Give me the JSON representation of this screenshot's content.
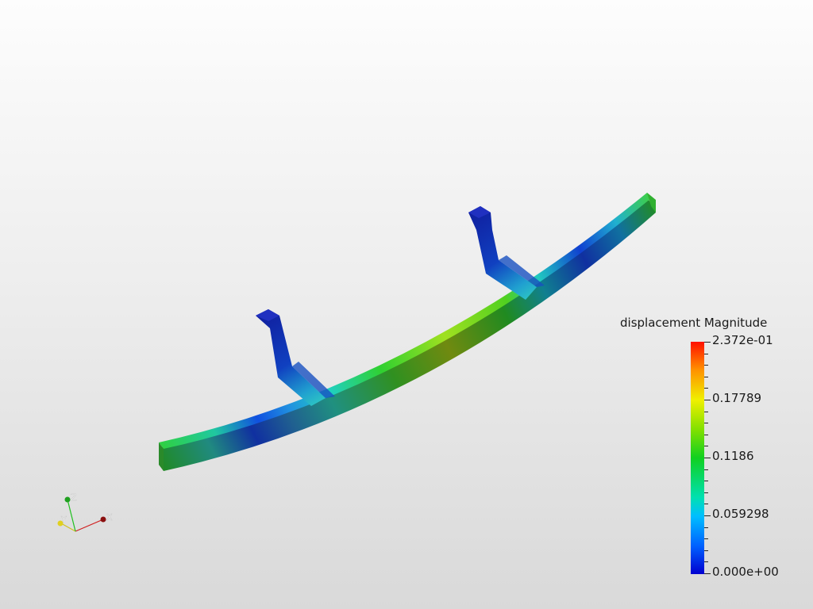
{
  "scalar_bar": {
    "title": "displacement Magnitude",
    "ticks": [
      "2.372e-01",
      "0.17789",
      "0.1186",
      "0.059298",
      "0.000e+00"
    ]
  },
  "axes": {
    "x": "X",
    "y": "Y",
    "z": "Z"
  },
  "colors": {
    "min": "#0000d0",
    "mid": "#10d020",
    "max": "#ff1000"
  }
}
